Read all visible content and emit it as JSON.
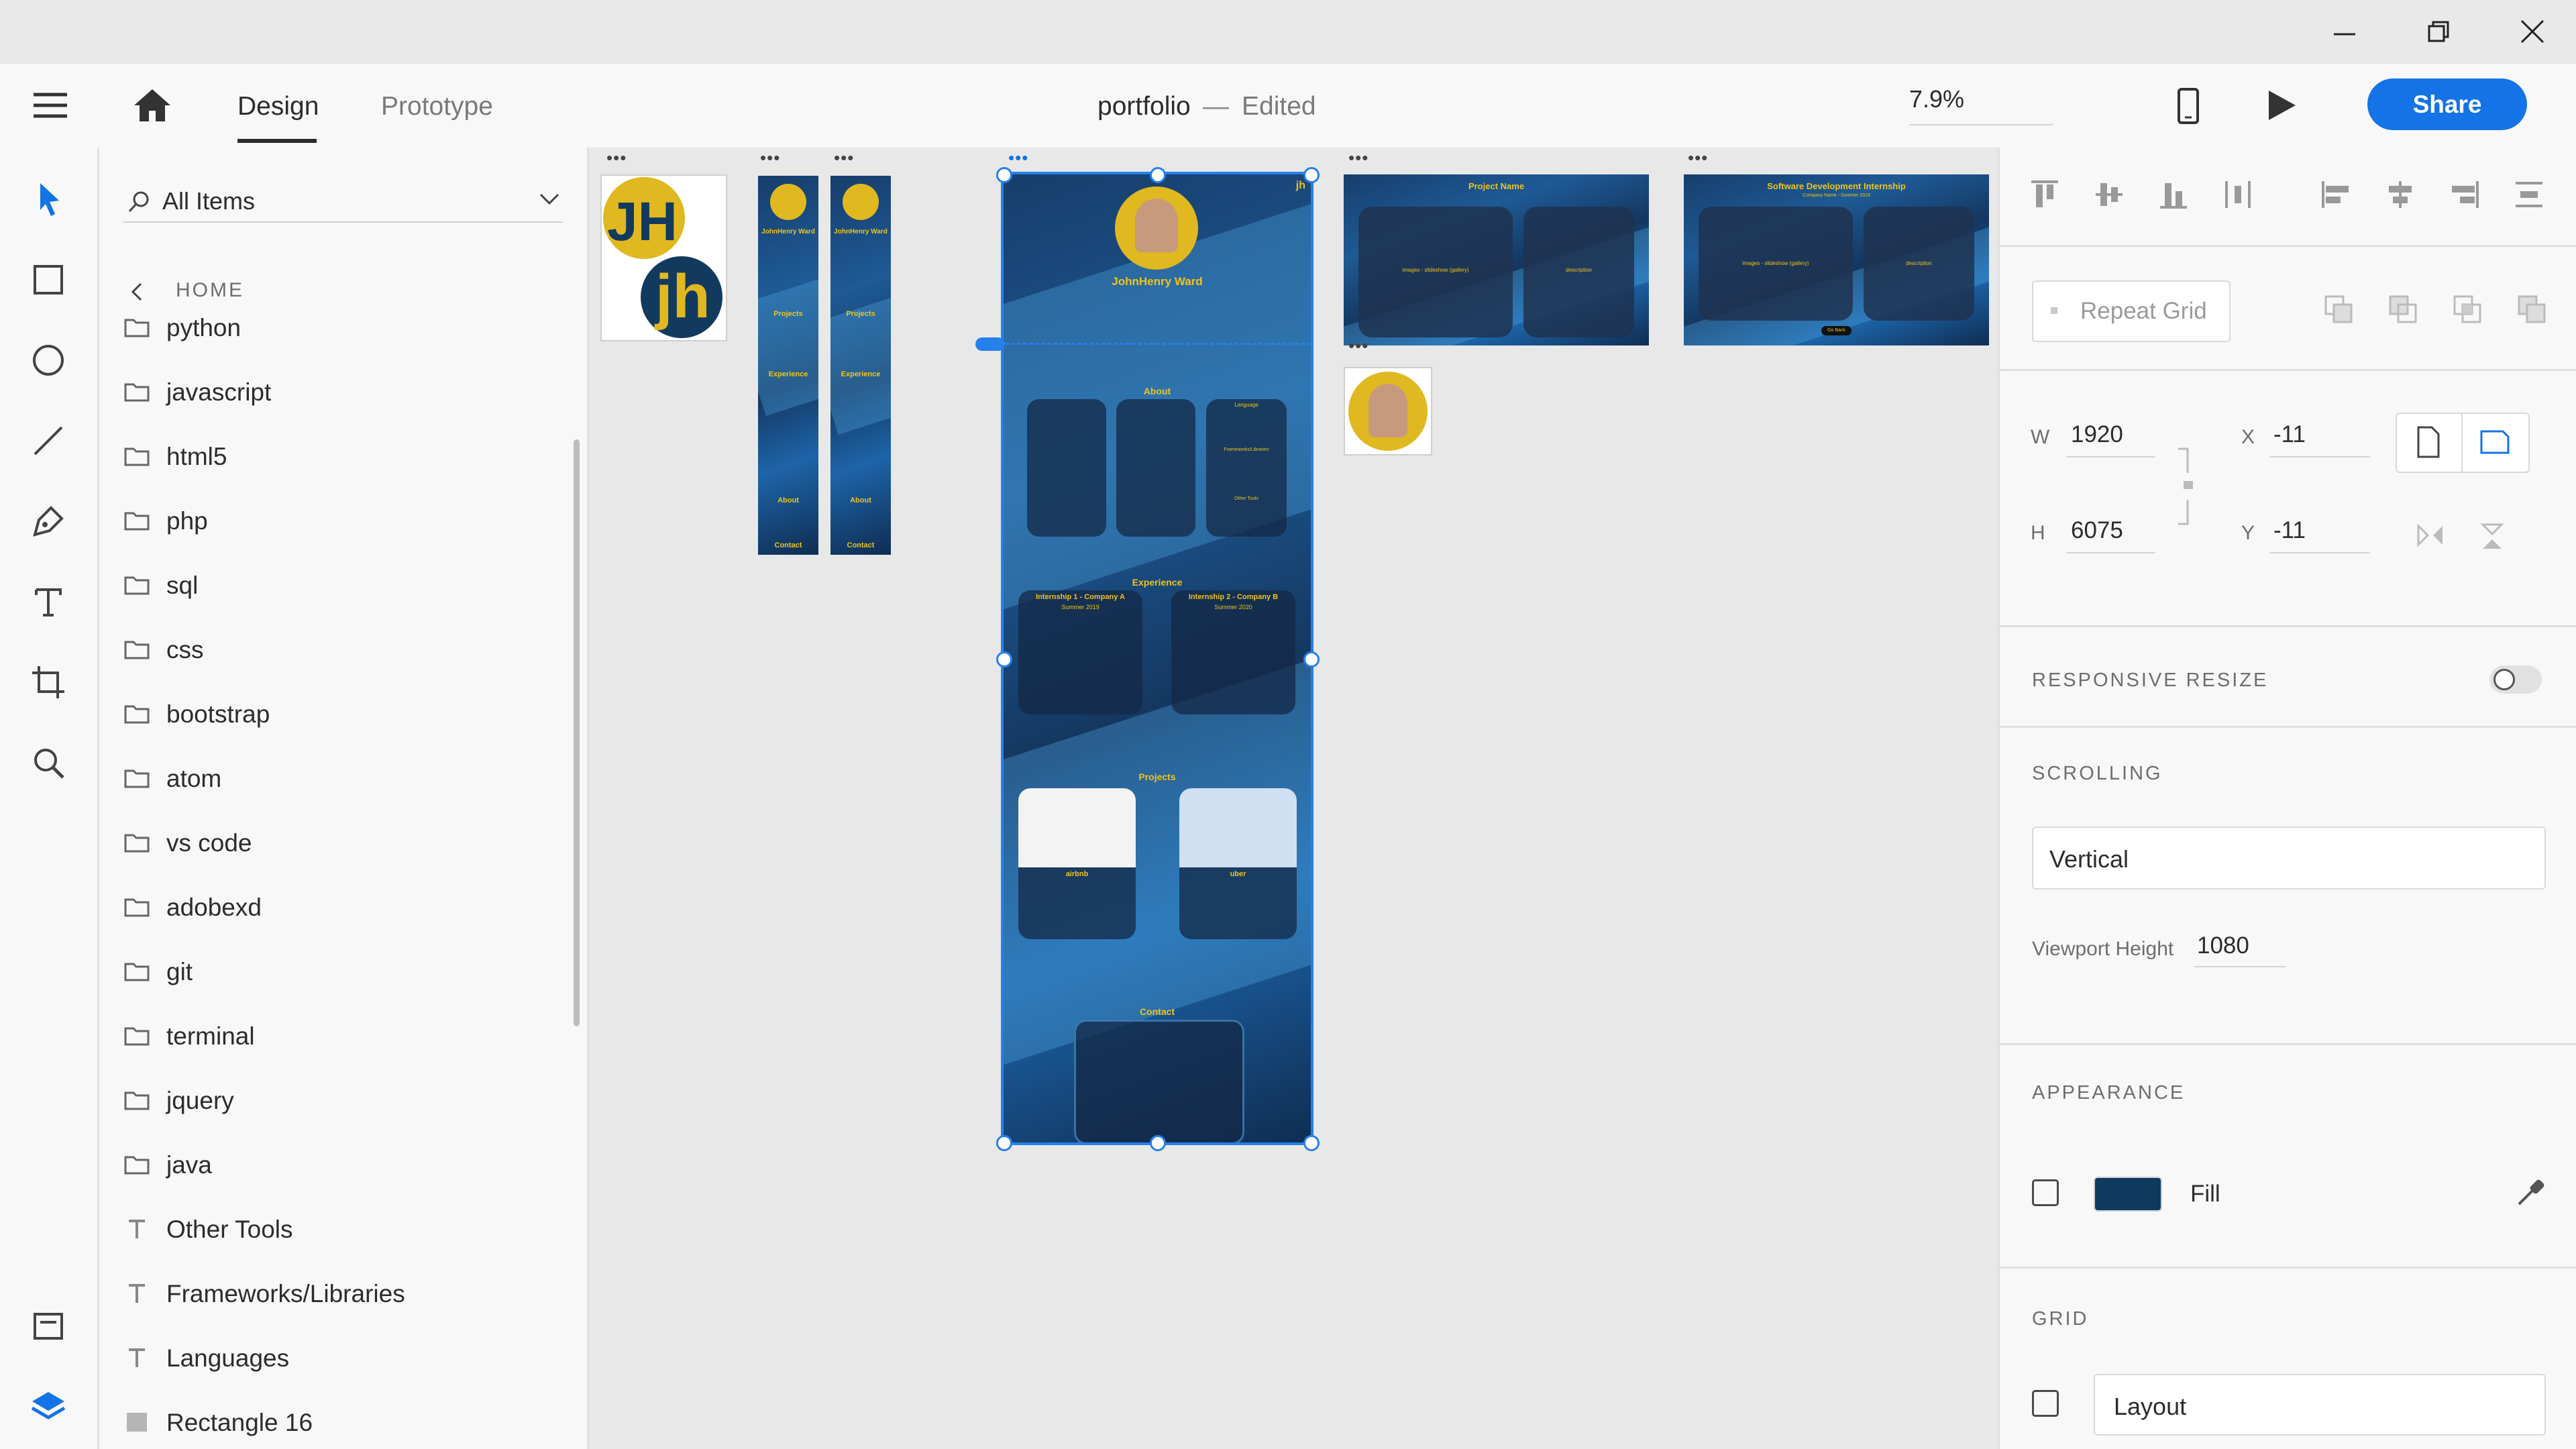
{
  "window": {
    "minimize": "minimize",
    "maximize": "restore",
    "close": "close"
  },
  "header": {
    "tabs": [
      {
        "label": "Design",
        "active": true
      },
      {
        "label": "Prototype",
        "active": false
      }
    ],
    "document_title": "portfolio",
    "separator": "—",
    "document_status": "Edited",
    "zoom": "7.9%",
    "share_label": "Share"
  },
  "toolbar": {
    "tools": [
      "select-icon",
      "rectangle-icon",
      "ellipse-icon",
      "line-icon",
      "pen-icon",
      "text-icon",
      "artboard-icon",
      "zoom-icon"
    ],
    "bottom": [
      "assets-panel-icon",
      "layers-icon"
    ]
  },
  "assets": {
    "filter_label": "All Items",
    "breadcrumb": "HOME",
    "items": [
      {
        "type": "folder",
        "label": "python"
      },
      {
        "type": "folder",
        "label": "javascript"
      },
      {
        "type": "folder",
        "label": "html5"
      },
      {
        "type": "folder",
        "label": "php"
      },
      {
        "type": "folder",
        "label": "sql"
      },
      {
        "type": "folder",
        "label": "css"
      },
      {
        "type": "folder",
        "label": "bootstrap"
      },
      {
        "type": "folder",
        "label": "atom"
      },
      {
        "type": "folder",
        "label": "vs code"
      },
      {
        "type": "folder",
        "label": "adobexd"
      },
      {
        "type": "folder",
        "label": "git"
      },
      {
        "type": "folder",
        "label": "terminal"
      },
      {
        "type": "folder",
        "label": "jquery"
      },
      {
        "type": "folder",
        "label": "java"
      },
      {
        "type": "text",
        "label": "Other Tools"
      },
      {
        "type": "text",
        "label": "Frameworks/Libraries"
      },
      {
        "type": "text",
        "label": "Languages"
      },
      {
        "type": "rect",
        "label": "Rectangle 16"
      }
    ]
  },
  "canvas": {
    "logo_text_top": "JH",
    "logo_text_bottom": "jh",
    "mobile_labels": {
      "name": "JohnHenry Ward",
      "projects": "Projects",
      "experience": "Experience",
      "about": "About",
      "contact": "Contact"
    },
    "main": {
      "corner_logo": "jh",
      "name": "JohnHenry Ward",
      "sections": {
        "about": "About",
        "experience": "Experience",
        "projects": "Projects",
        "contact": "Contact"
      },
      "skills": {
        "languages": "Language",
        "frameworks": "Frameworks/Libraries",
        "tools": "Other Tools"
      },
      "experience": [
        {
          "title": "Internship 1 - Company A",
          "date": "Summer 2019"
        },
        {
          "title": "Internship 2 - Company B",
          "date": "Summer 2020"
        }
      ],
      "projects": [
        {
          "name": "airbnb"
        },
        {
          "name": "uber"
        }
      ]
    },
    "project_template": {
      "title": "Project Name",
      "left": "images - slideshow (gallery)",
      "right": "description"
    },
    "internship_template": {
      "title": "Software Development Internship",
      "subtitle": "Company Name - Summer 2019",
      "left": "images - slideshow (gallery)",
      "right": "description",
      "button": "Go Back"
    }
  },
  "inspector": {
    "repeat_grid": "Repeat Grid",
    "w_label": "W",
    "w_value": "1920",
    "h_label": "H",
    "h_value": "6075",
    "x_label": "X",
    "x_value": "-11",
    "y_label": "Y",
    "y_value": "-11",
    "responsive_resize": "RESPONSIVE RESIZE",
    "responsive_on": false,
    "scrolling": "SCROLLING",
    "scrolling_value": "Vertical",
    "viewport_label": "Viewport Height",
    "viewport_value": "1080",
    "appearance": "APPEARANCE",
    "fill_label": "Fill",
    "fill_color": "#0f3a5f",
    "grid": "GRID",
    "grid_value": "Layout"
  },
  "colors": {
    "accent": "#1473e6",
    "canvas_bg": "#e8e8e8",
    "artboard_blue": "#1b4f86",
    "highlight_yellow": "#f0c419"
  }
}
